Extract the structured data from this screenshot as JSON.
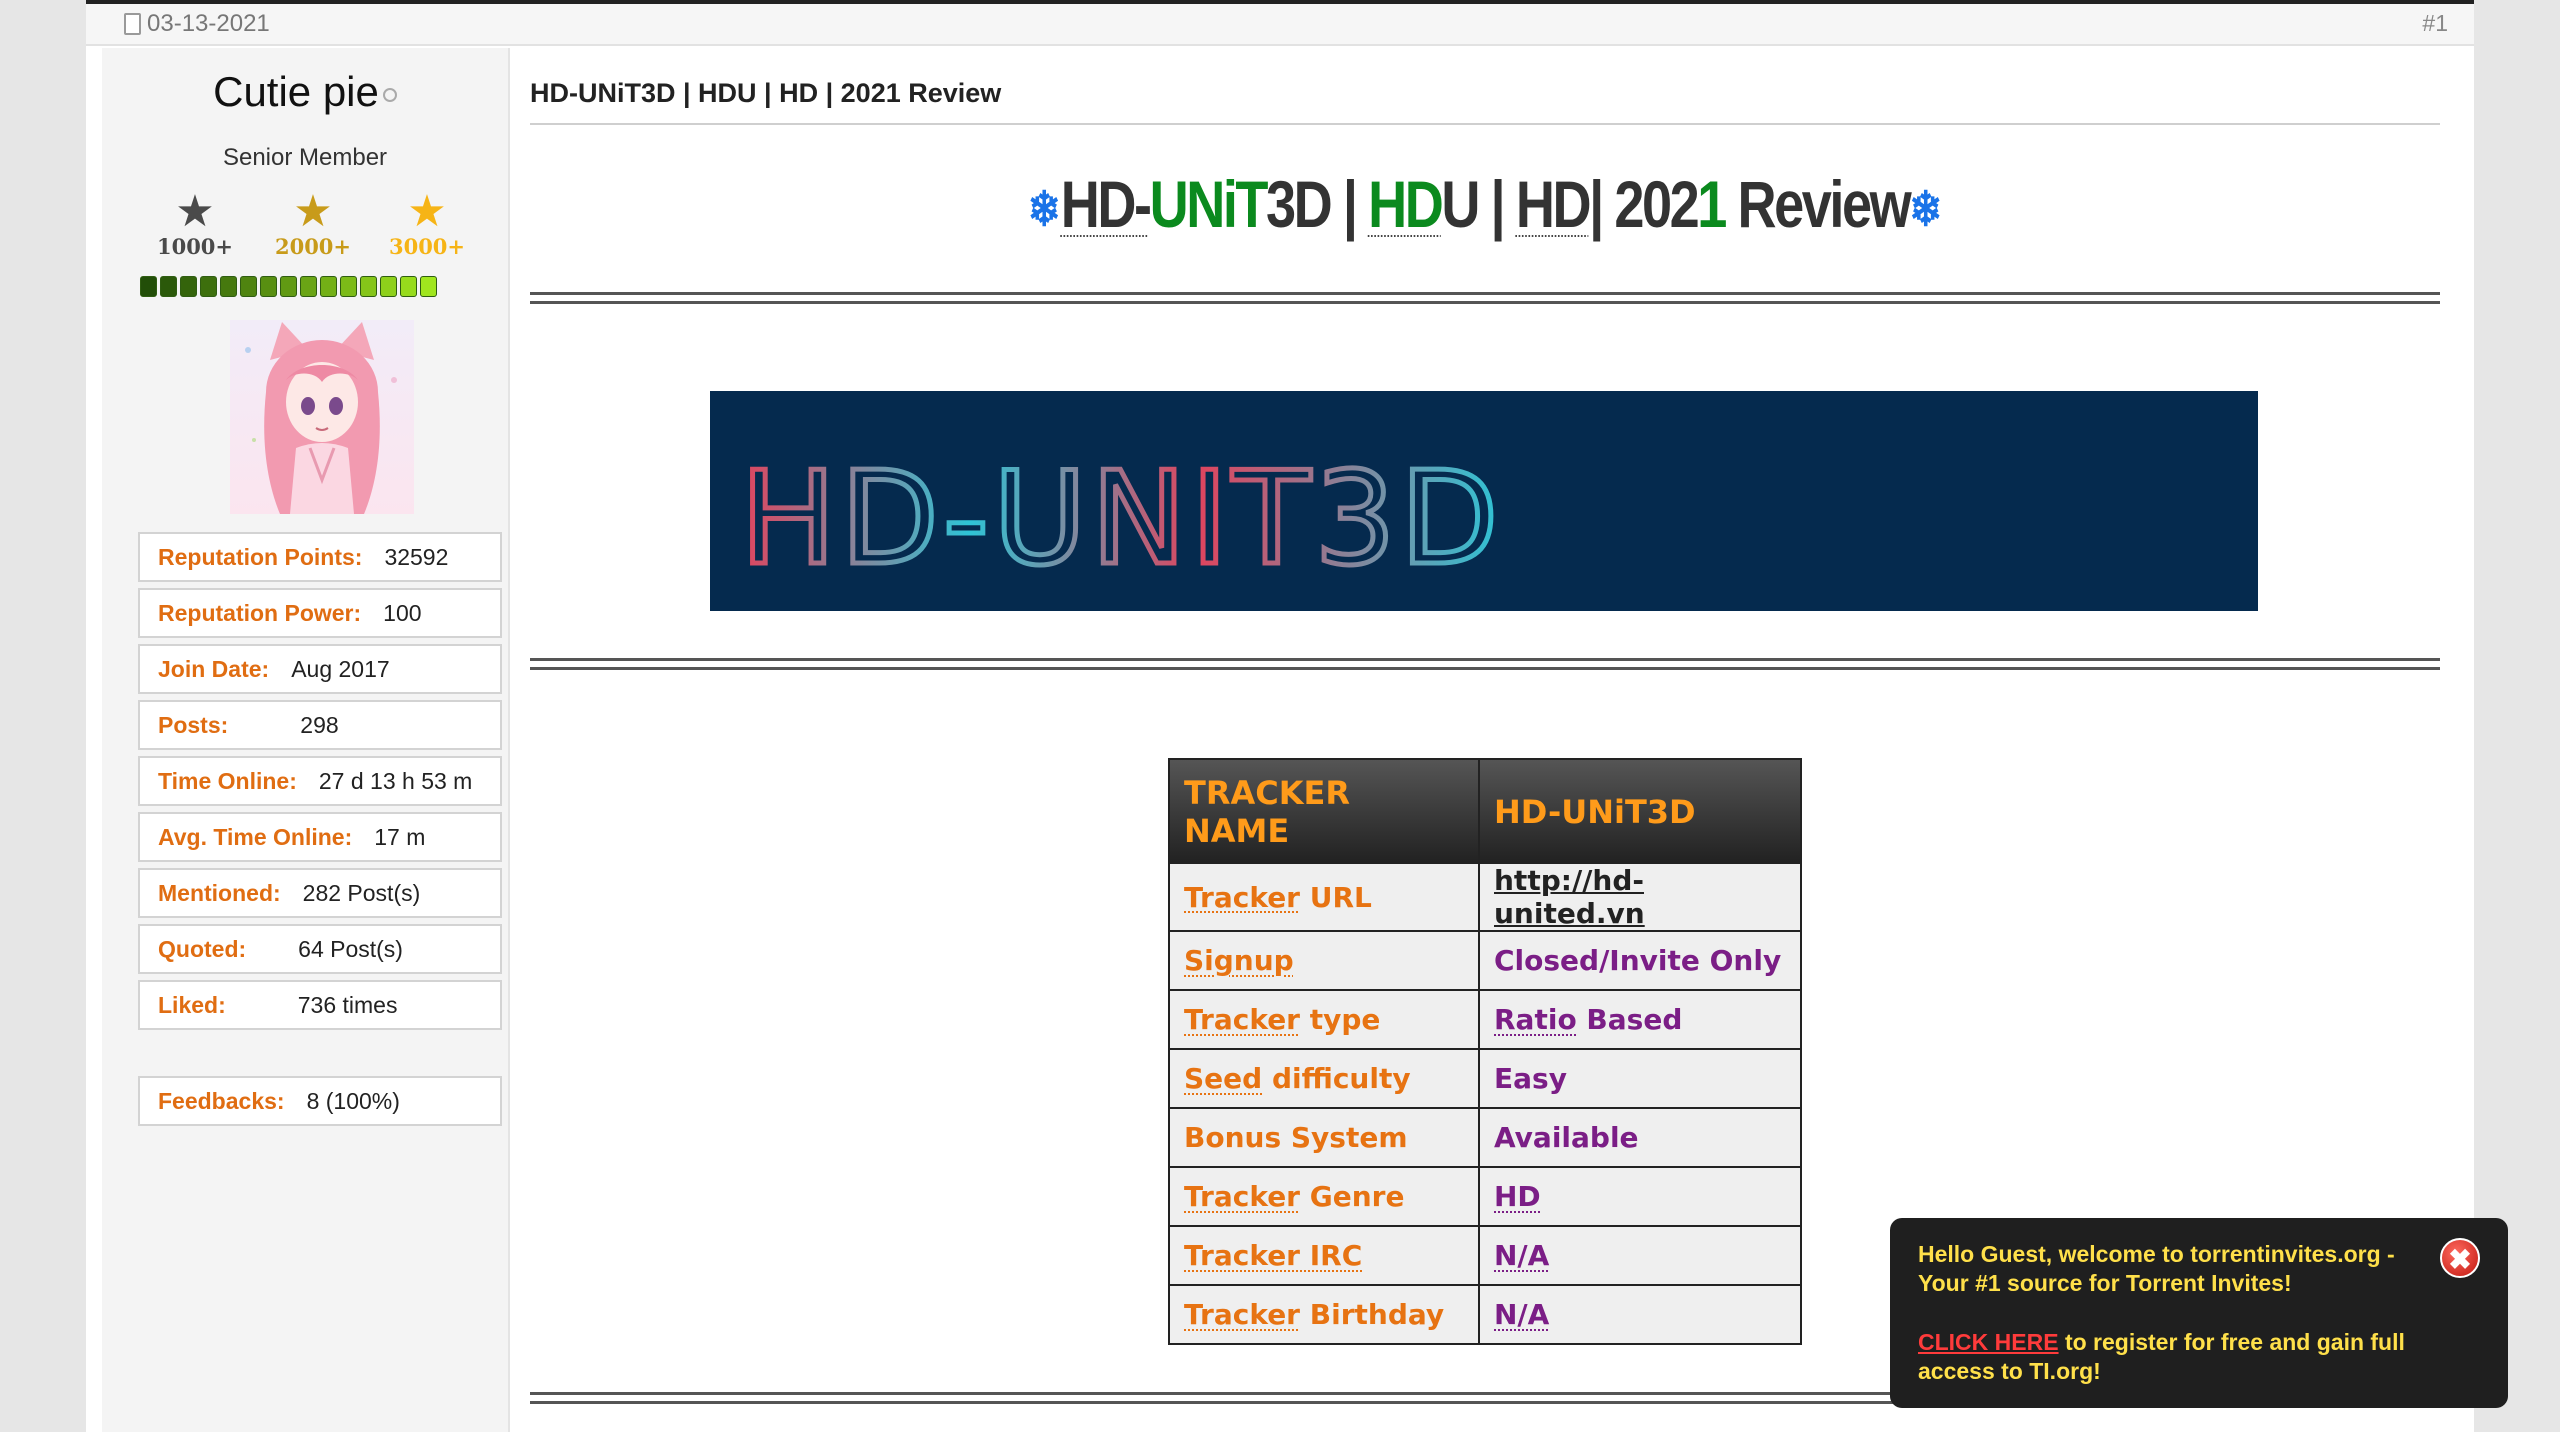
{
  "post": {
    "date": "03-13-2021",
    "number": "#1",
    "title": "HD-UNiT3D | HDU | HD | 2021 Review"
  },
  "user": {
    "name": "Cutie pie",
    "title": "Senior Member",
    "awards": [
      {
        "label": "1000+",
        "color": "#4a4a4a"
      },
      {
        "label": "2000+",
        "color": "#c89b1a"
      },
      {
        "label": "3000+",
        "color": "#f6b416"
      }
    ],
    "reputation_bar_filled": 15,
    "stats": [
      {
        "key": "Reputation Points:",
        "value": "32592"
      },
      {
        "key": "Reputation Power:",
        "value": "100"
      },
      {
        "key": "Join Date:",
        "value": "Aug 2017"
      },
      {
        "key": "Posts:",
        "value": "298"
      },
      {
        "key": "Time Online:",
        "value": "27 d 13 h 53 m"
      },
      {
        "key": "Avg. Time Online:",
        "value": "17 m"
      },
      {
        "key": "Mentioned:",
        "value": "282 Post(s)"
      },
      {
        "key": "Quoted:",
        "value": "64 Post(s)"
      },
      {
        "key": "Liked:",
        "value": "736 times"
      }
    ],
    "feedback": {
      "key": "Feedbacks:",
      "value": "8 (100%)"
    }
  },
  "heading": {
    "part1": "HD-",
    "part2": "UNiT",
    "part3": "3D | ",
    "part4": "HD",
    "part5": "U | ",
    "part6": "HD",
    "part7": "| 202",
    "part8": "1",
    "part9": " Review",
    "snowflake": "❄"
  },
  "banner": {
    "text": "HD-UNIT3D"
  },
  "table": {
    "header": {
      "name": "TRACKER NAME",
      "value": "HD-UNiT3D"
    },
    "rows": [
      {
        "k1": "Tracker",
        "k2": " URL",
        "v": "http://hd-united.vn"
      },
      {
        "k1": "Signup",
        "k2": "",
        "v": "Closed/Invite Only"
      },
      {
        "k1": "Tracker",
        "k2": " type",
        "v1": "Ratio",
        "v2": " Based"
      },
      {
        "k1": "Seed",
        "k2": " difficulty",
        "v": "Easy"
      },
      {
        "k1": "Bonus System",
        "k2": "",
        "v": "Available"
      },
      {
        "k1": "Tracker",
        "k2": " Genre",
        "v": "HD"
      },
      {
        "k1": "Tracker",
        "k2": " IRC",
        "v": "N/A"
      },
      {
        "k1": "Tracker",
        "k2": " Birthday",
        "v": "N/A"
      }
    ]
  },
  "popup": {
    "line1": "Hello Guest, welcome to torrentinvites.org - Your #1 source for Torrent Invites!",
    "click": "CLICK HERE",
    "line2": " to register for free and gain full access to TI.org!"
  }
}
